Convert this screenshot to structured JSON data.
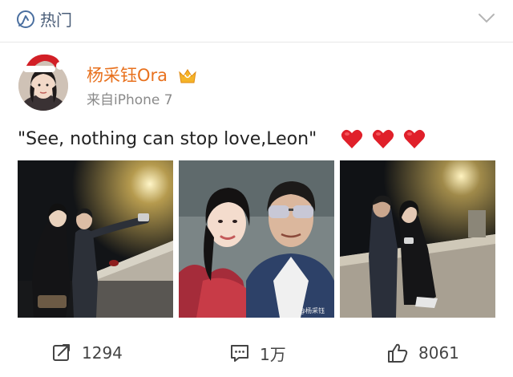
{
  "header": {
    "title": "热门"
  },
  "post": {
    "author": "杨采钰Ora",
    "source": "来自iPhone 7",
    "text": "\"See, nothing can stop love,Leon\"",
    "watermark": "@杨采钰"
  },
  "actions": {
    "repost_count": "1294",
    "comment_count": "1万",
    "like_count": "8061"
  },
  "colors": {
    "username": "#e8711e",
    "heart": "#e0202a",
    "header_text": "#4a5d78"
  },
  "icons": [
    "hot-topic-icon",
    "chevron-down-icon",
    "santa-hat-icon",
    "vip-crown-icon",
    "heart-icon",
    "repost-icon",
    "comment-icon",
    "like-icon"
  ]
}
